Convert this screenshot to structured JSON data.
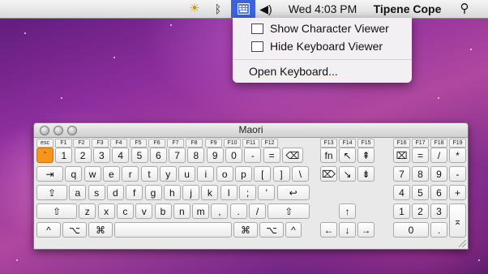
{
  "menubar": {
    "sun_icon": "☀",
    "bluetooth_icon": "ᛒ",
    "volume_icon": "◀)",
    "clock": "Wed 4:03 PM",
    "user": "Tipene Cope",
    "search_icon": "⚲",
    "input_menu_active": true,
    "highlight_color": "#3d63d8"
  },
  "dropdown": {
    "items": [
      {
        "label": "Show Character Viewer"
      },
      {
        "label": "Hide Keyboard Viewer"
      },
      {
        "label": "Open Keyboard..."
      }
    ]
  },
  "keyboard": {
    "title": "Maori",
    "fkeys": [
      "esc",
      "F1",
      "F2",
      "F3",
      "F4",
      "F5",
      "F6",
      "F7",
      "F8",
      "F9",
      "F10",
      "F11",
      "F12",
      "F13",
      "F14",
      "F15",
      "F16",
      "F17",
      "F18",
      "F19"
    ],
    "row1": [
      "`",
      "1",
      "2",
      "3",
      "4",
      "5",
      "6",
      "7",
      "8",
      "9",
      "0",
      "-",
      "=",
      "⌫"
    ],
    "row2": [
      "⇥",
      "q",
      "w",
      "e",
      "r",
      "t",
      "y",
      "u",
      "i",
      "o",
      "p",
      "[",
      "]",
      "\\"
    ],
    "row3": [
      "⇪",
      "a",
      "s",
      "d",
      "f",
      "g",
      "h",
      "j",
      "k",
      "l",
      ";",
      "'",
      "↩"
    ],
    "row4": [
      "⇧",
      "z",
      "x",
      "c",
      "v",
      "b",
      "n",
      "m",
      ",",
      ".",
      "/",
      "⇧"
    ],
    "row5": [
      "^",
      "⌥",
      "⌘",
      "",
      "⌘",
      "⌥",
      "^"
    ],
    "nav": [
      "fn",
      "↖",
      "⇞",
      "⌦",
      "↘",
      "⇟",
      "↑",
      "←",
      "↓",
      "→"
    ],
    "numpad": [
      "⌧",
      "=",
      "/",
      "*",
      "7",
      "8",
      "9",
      "-",
      "4",
      "5",
      "6",
      "+",
      "1",
      "2",
      "3",
      "⌅",
      "0",
      "."
    ],
    "highlighted_key": "`",
    "highlight_color": "#f5951e"
  }
}
